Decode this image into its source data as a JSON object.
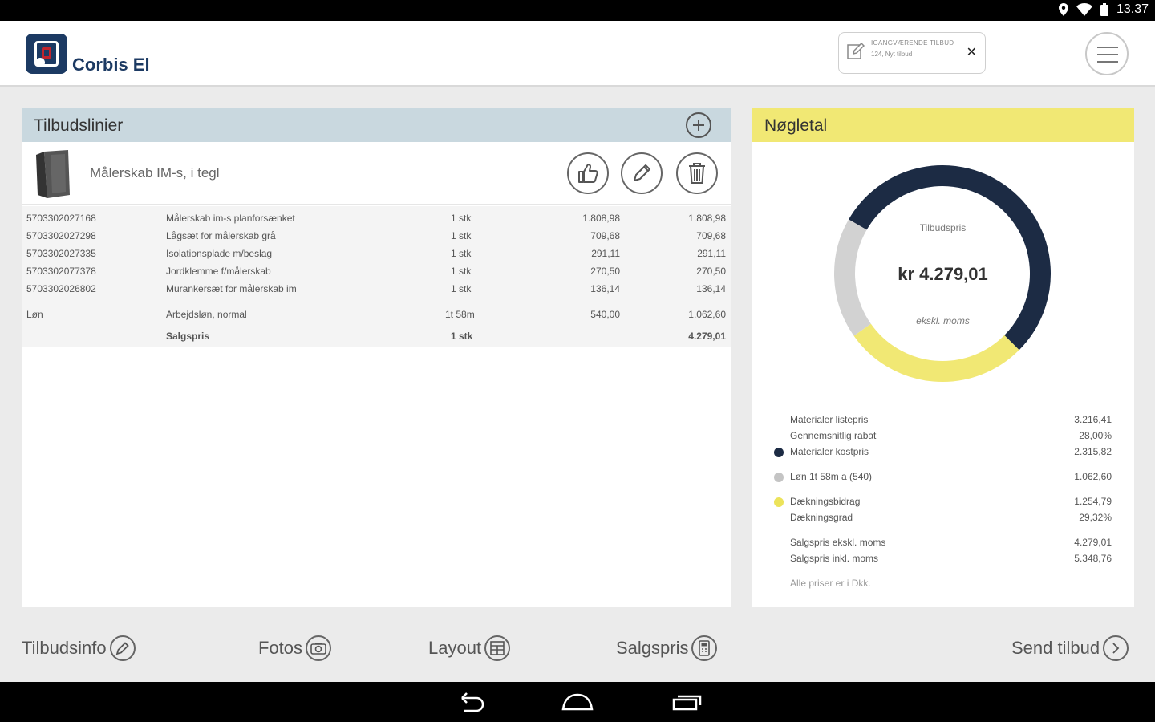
{
  "status_bar": {
    "time": "13.37"
  },
  "header": {
    "app_name": "Corbis El",
    "draft": {
      "line1": "IGANGVÆRENDE TILBUD",
      "line2": "124, Nyt tilbud"
    }
  },
  "offer_lines": {
    "title": "Tilbudslinier",
    "product_name": "Målerskab IM-s, i tegl",
    "rows": [
      {
        "code": "5703302027168",
        "desc": "Målerskab im-s planforsænket",
        "qty": "1 stk",
        "price": "1.808,98",
        "total": "1.808,98"
      },
      {
        "code": "5703302027298",
        "desc": "Lågsæt for målerskab grå",
        "qty": "1 stk",
        "price": "709,68",
        "total": "709,68"
      },
      {
        "code": "5703302027335",
        "desc": "Isolationsplade m/beslag",
        "qty": "1 stk",
        "price": "291,11",
        "total": "291,11"
      },
      {
        "code": "5703302077378",
        "desc": "Jordklemme f/målerskab",
        "qty": "1 stk",
        "price": "270,50",
        "total": "270,50"
      },
      {
        "code": "5703302026802",
        "desc": "Murankersæt for målerskab im",
        "qty": "1 stk",
        "price": "136,14",
        "total": "136,14"
      }
    ],
    "labor": {
      "code": "Løn",
      "desc": "Arbejdsløn, normal",
      "qty": "1t 58m",
      "price": "540,00",
      "total": "1.062,60"
    },
    "sales": {
      "desc": "Salgspris",
      "qty": "1 stk",
      "total": "4.279,01"
    }
  },
  "key_figures": {
    "title": "Nøgletal",
    "donut_label": "Tilbudspris",
    "donut_value": "kr 4.279,01",
    "donut_note": "ekskl. moms",
    "segments": [
      {
        "name": "Materialer kostpris",
        "fraction": 0.5413,
        "color": "#1c2b44"
      },
      {
        "name": "Løn",
        "fraction": 0.1808,
        "color": "#d2d2d2"
      },
      {
        "name": "Dækningsbidrag",
        "fraction": 0.2779,
        "color": "#f1e874"
      }
    ],
    "stats": {
      "list_price": {
        "label": "Materialer listepris",
        "value": "3.216,41"
      },
      "avg_discount": {
        "label": "Gennemsnitlig rabat",
        "value": "28,00%"
      },
      "cost_price": {
        "label": "Materialer kostpris",
        "value": "2.315,82"
      },
      "labor": {
        "label": "Løn 1t 58m a (540)",
        "value": "1.062,60"
      },
      "contribution": {
        "label": "Dækningsbidrag",
        "value": "1.254,79"
      },
      "coverage": {
        "label": "Dækningsgrad",
        "value": "29,32%"
      },
      "sales_excl": {
        "label": "Salgspris ekskl. moms",
        "value": "4.279,01"
      },
      "sales_incl": {
        "label": "Salgspris inkl. moms",
        "value": "5.348,76"
      },
      "note": "Alle priser er i Dkk."
    }
  },
  "toolbar": {
    "info": "Tilbudsinfo",
    "photos": "Fotos",
    "layout": "Layout",
    "price": "Salgspris",
    "send": "Send tilbud"
  }
}
